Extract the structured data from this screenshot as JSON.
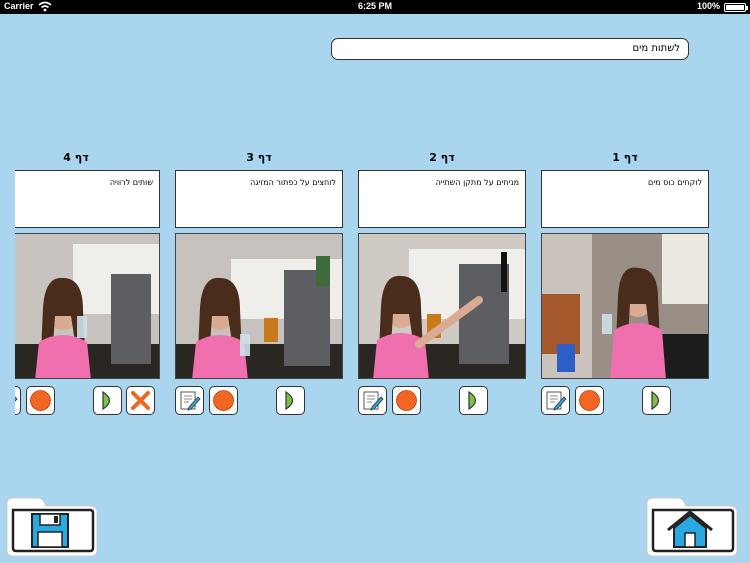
{
  "status_bar": {
    "carrier": "Carrier",
    "time": "6:25 PM",
    "battery": "100%"
  },
  "story": {
    "title": "לשתות מים"
  },
  "pages": [
    {
      "title": "דף 1",
      "text": "לוקחים כוס מים"
    },
    {
      "title": "דף 2",
      "text": "מניחים על מתקן השתייה"
    },
    {
      "title": "דף 3",
      "text": "לוחצים על כפתור המזיגה"
    },
    {
      "title": "דף 4",
      "text": "שותים לרוויה"
    }
  ],
  "colors": {
    "background": "#a9d6ee",
    "record": "#f26522",
    "delete": "#f26522",
    "play": "#7dc142",
    "save": "#2aa8e0",
    "home": "#2aa8e0"
  },
  "icons": {
    "edit": "edit-icon",
    "record": "record-icon",
    "play": "play-icon",
    "delete": "delete-icon",
    "save": "save-icon",
    "home": "home-icon"
  }
}
